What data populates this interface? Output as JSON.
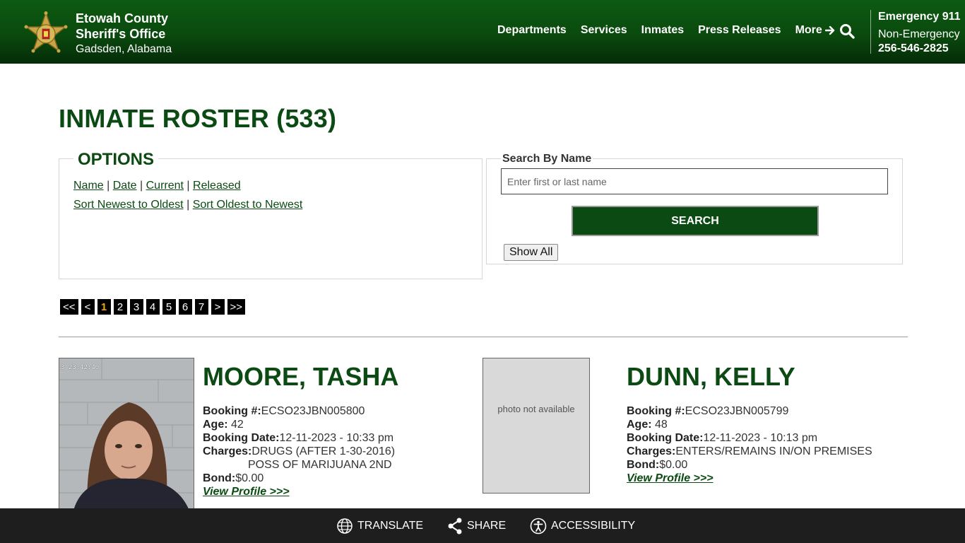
{
  "header": {
    "org_line1": "Etowah County",
    "org_line2": "Sheriff's Office",
    "org_line3": "Gadsden, Alabama",
    "nav": [
      "Departments",
      "Services",
      "Inmates",
      "Press Releases",
      "More"
    ],
    "emergency": "Emergency 911",
    "non_emergency_label": "Non-Emergency",
    "non_emergency_number": "256-546-2825"
  },
  "page": {
    "title": "INMATE ROSTER (533)"
  },
  "options": {
    "legend": "OPTIONS",
    "links_row1": [
      "Name",
      "Date",
      "Current",
      "Released"
    ],
    "links_row2": [
      "Sort Newest to Oldest",
      "Sort Oldest to Newest"
    ]
  },
  "search": {
    "label": "Search By Name",
    "placeholder": "Enter first or last name",
    "button": "SEARCH",
    "show_all": "Show All"
  },
  "pagination": {
    "first": "<<",
    "prev": "<",
    "pages": [
      "1",
      "2",
      "3",
      "4",
      "5",
      "6",
      "7"
    ],
    "current": "1",
    "next": ">",
    "last": ">>"
  },
  "inmates": [
    {
      "name": "MOORE, TASHA",
      "photo_stamp": "3  23:42:40",
      "booking_label": "Booking #:",
      "booking": "ECSO23JBN005800",
      "age_label": "Age:",
      "age": "42",
      "date_label": "Booking Date:",
      "booking_date": "12-11-2023 - 10:33 pm",
      "charges_label": "Charges:",
      "charges": [
        "DRUGS (AFTER 1-30-2016)",
        "POSS OF MARIJUANA 2ND"
      ],
      "bond_label": "Bond:",
      "bond": "$0.00",
      "profile_link": "View Profile >>>"
    },
    {
      "name": "DUNN, KELLY",
      "photo_placeholder": "photo not available",
      "booking_label": "Booking #:",
      "booking": "ECSO23JBN005799",
      "age_label": "Age:",
      "age": "48",
      "date_label": "Booking Date:",
      "booking_date": "12-11-2023 - 10:13 pm",
      "charges_label": "Charges:",
      "charges": [
        "ENTERS/REMAINS IN/ON PREMISES"
      ],
      "bond_label": "Bond:",
      "bond": "$0.00",
      "profile_link": "View Profile >>>"
    }
  ],
  "footer": {
    "translate": "TRANSLATE",
    "share": "SHARE",
    "accessibility": "ACCESSIBILITY"
  },
  "colors": {
    "brand_green": "#0b4a12",
    "pager_current": "#f0a21a",
    "footer_bg": "#1e1e1e"
  }
}
